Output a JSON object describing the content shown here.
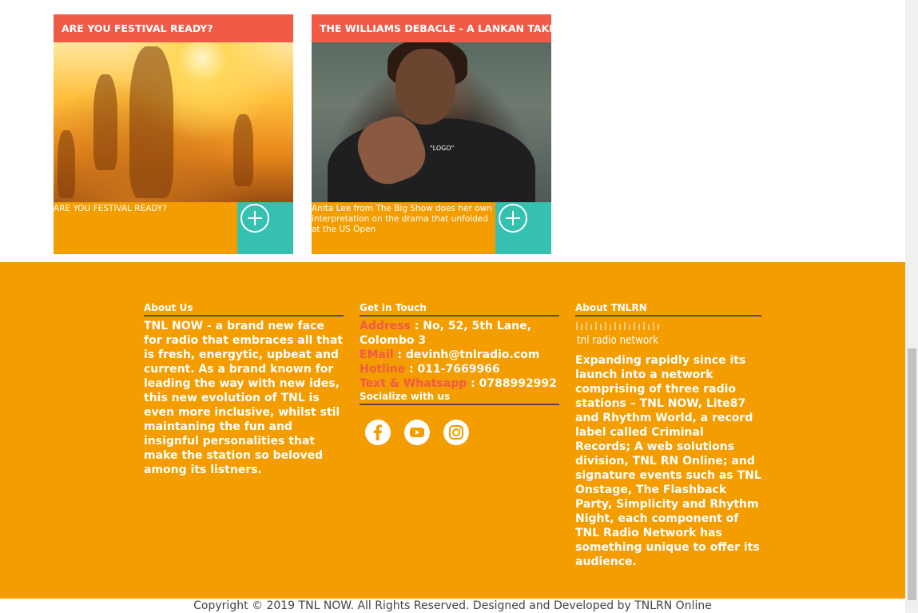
{
  "cards": [
    {
      "title": "ARE YOU FESTIVAL READY?",
      "description": "ARE YOU FESTIVAL READY?"
    },
    {
      "title": "THE WILLIAMS DEBACLE - A LANKAN TAKE",
      "description": "Anita Lee from The Big Show does her own interpretation on the drama that unfolded at the US Open",
      "image_text": "\"LOGO\""
    }
  ],
  "footer": {
    "about": {
      "heading": "About Us",
      "text": "TNL NOW - a brand new face for radio that embraces all that is fresh, energytic, upbeat and current. As a brand known for leading the way with new ides, this new evolution of TNL is even more inclusive, whilst stil maintaning the fun and insignful personalities that make the station so beloved among its listners."
    },
    "contact": {
      "heading": "Get in Touch",
      "address_label": "Address",
      "address_value": " : No, 52, 5th Lane, Colombo 3",
      "email_label": "EMail",
      "email_value": " : devinh@tnlradio.com",
      "hotline_label": "Hotline",
      "hotline_value": " : 011-7669966",
      "whatsapp_label": "Text & Whatsapp",
      "whatsapp_value": " : 0788992992",
      "social_heading": "Socialize with us",
      "socials": [
        "facebook-icon",
        "youtube-icon",
        "instagram-icon"
      ]
    },
    "network": {
      "heading": "About TNLRN",
      "logo_text": "tnl radio network",
      "text": "Expanding rapidly since its launch into a network comprising of three radio stations – TNL NOW, Lite87 and Rhythm World, a record label called Criminal Records; A web solutions division, TNL RN Online; and signature events such as TNL Onstage, The Flashback Party, Simplicity and Rhythm Night, each component of TNL Radio Network has something unique to offer its audience."
    }
  },
  "copyright": "Copyright © 2019 TNL NOW. All Rights Reserved. Designed and Developed by TNLRN Online",
  "colors": {
    "accent_red": "#f05a47",
    "orange": "#f49d00",
    "teal": "#35c0b0"
  }
}
